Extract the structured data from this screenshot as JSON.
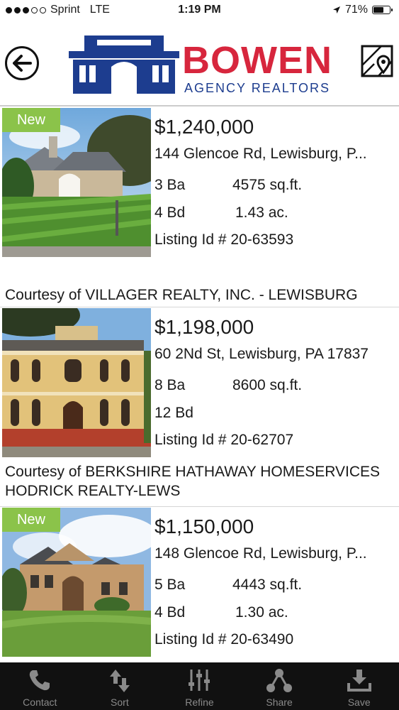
{
  "status_bar": {
    "carrier": "Sprint",
    "network": "LTE",
    "time": "1:19 PM",
    "battery_percent": "71%",
    "battery_level": 0.71,
    "signal_bars_filled": 3,
    "signal_bars_total": 5
  },
  "header": {
    "brand_name": "BOWEN",
    "brand_sub": "AGENCY REALTORS",
    "brand_colors": {
      "red": "#d7263d",
      "blue": "#1d3d8f"
    }
  },
  "listings": [
    {
      "badge": "New",
      "price": "$1,240,000",
      "address": "144 Glencoe Rd, Lewisburg, P...",
      "baths": "3 Ba",
      "sqft": "4575 sq.ft.",
      "beds": "4 Bd",
      "acres": "1.43 ac.",
      "listing_id": "Listing Id # 20-63593",
      "courtesy": "Courtesy of VILLAGER REALTY, INC. - LEWISBURG"
    },
    {
      "badge": "",
      "price": "$1,198,000",
      "address": "60 2Nd St, Lewisburg, PA  17837",
      "baths": "8 Ba",
      "sqft": "8600 sq.ft.",
      "beds": "12 Bd",
      "acres": "",
      "listing_id": "Listing Id # 20-62707",
      "courtesy": "Courtesy of BERKSHIRE HATHAWAY HOMESERVICES HODRICK REALTY-LEWS"
    },
    {
      "badge": "New",
      "price": "$1,150,000",
      "address": "148 Glencoe Rd, Lewisburg, P...",
      "baths": "5 Ba",
      "sqft": "4443 sq.ft.",
      "beds": "4 Bd",
      "acres": "1.30 ac.",
      "listing_id": "Listing Id # 20-63490",
      "courtesy": ""
    }
  ],
  "tab_bar": {
    "tabs": [
      {
        "label": "Contact",
        "icon": "phone-icon"
      },
      {
        "label": "Sort",
        "icon": "sort-icon"
      },
      {
        "label": "Refine",
        "icon": "sliders-icon"
      },
      {
        "label": "Share",
        "icon": "share-icon"
      },
      {
        "label": "Save",
        "icon": "download-icon"
      }
    ]
  }
}
